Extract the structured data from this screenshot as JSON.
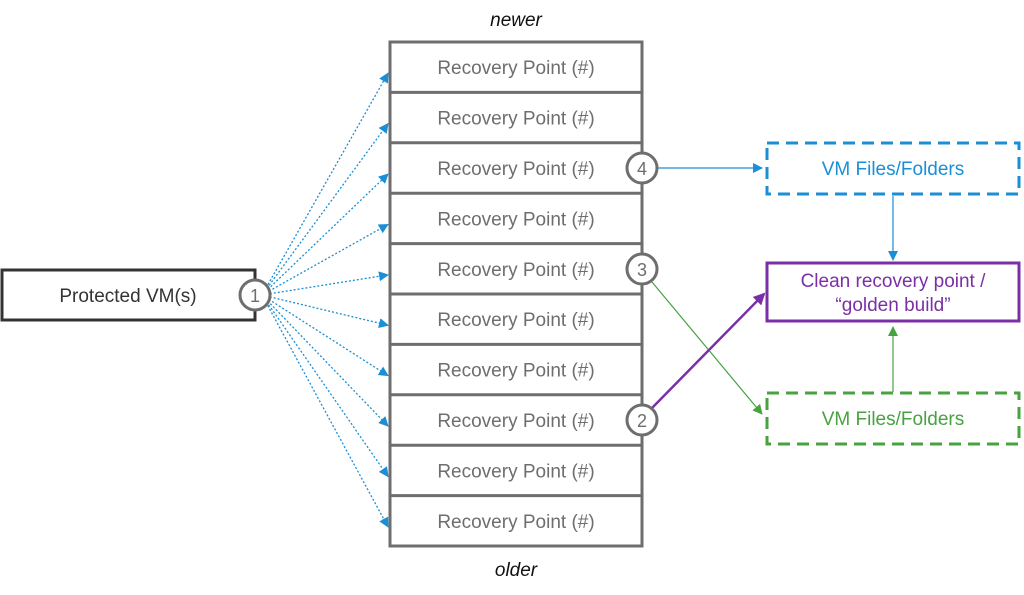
{
  "labels": {
    "newer": "newer",
    "older": "older",
    "protected_vm": "Protected VM(s)",
    "recovery_points": [
      "Recovery Point (#)",
      "Recovery Point (#)",
      "Recovery Point (#)",
      "Recovery Point (#)",
      "Recovery Point (#)",
      "Recovery Point (#)",
      "Recovery Point (#)",
      "Recovery Point (#)",
      "Recovery Point (#)",
      "Recovery Point (#)"
    ],
    "vm_files_top": "VM Files/Folders",
    "vm_files_bottom": "VM Files/Folders",
    "golden_line1": "Clean recovery point /",
    "golden_line2": "“golden build”"
  },
  "markers": [
    "1",
    "2",
    "3",
    "4"
  ],
  "colors": {
    "gray": "#6e6e6e",
    "dark": "#333333",
    "blue": "#1a8fd6",
    "green": "#47a23f",
    "purple": "#7b2fa6"
  }
}
